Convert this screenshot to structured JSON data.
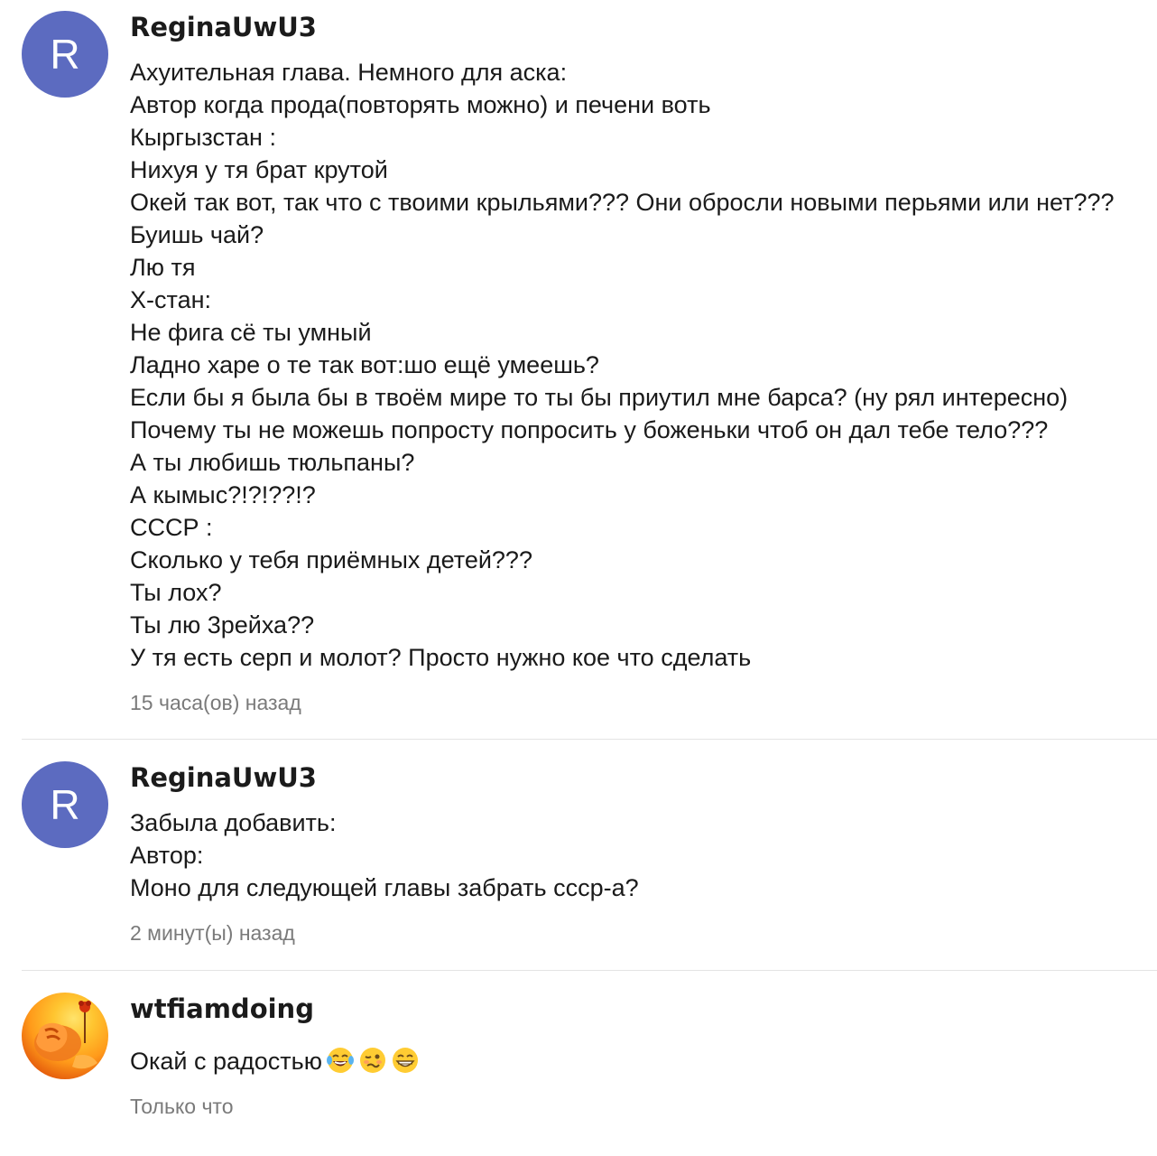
{
  "comments": [
    {
      "author": "ReginaUwU3",
      "avatar_letter": "R",
      "avatar_color": "#5c6bc0",
      "lines": [
        "Ахуительная глава. Немного для аска:",
        "Автор когда прода(повторять можно) и печени воть",
        "Кыргызстан :",
        "Нихуя у тя брат крутой",
        "Окей так вот, так что с твоими крыльями??? Они обросли новыми перьями или нет???",
        "Буишь чай?",
        "Лю тя",
        "Х-стан:",
        "Не фига сё ты умный",
        "Ладно харе о те так вот:шо ещё умеешь?",
        "Если бы я была бы в твоём мире то ты бы приутил мне барса? (ну рял интересно)",
        "Почему ты не можешь попросту попросить у боженьки чтоб он дал тебе тело???",
        "А ты любишь тюльпаны?",
        "А кымыс?!?!??!?",
        "СССР :",
        "Сколько у тебя приёмных детей???",
        "Ты лох?",
        "Ты лю 3рейха??",
        "У тя есть серп и молот? Просто нужно кое что сделать"
      ],
      "time": "15 часа(ов) назад"
    },
    {
      "author": "ReginaUwU3",
      "avatar_letter": "R",
      "avatar_color": "#5c6bc0",
      "lines": [
        "Забыла добавить:",
        "Автор:",
        "Моно для следующей главы забрать ссср-а?"
      ],
      "time": "2 минут(ы) назад"
    },
    {
      "author": "wtfiamdoing",
      "avatar_icon": "hand-flower-image",
      "text": "Окай с радостью",
      "emojis": [
        "tears-of-joy-emoji",
        "woozy-face-emoji",
        "grinning-face-emoji"
      ],
      "time": "Только что"
    }
  ]
}
